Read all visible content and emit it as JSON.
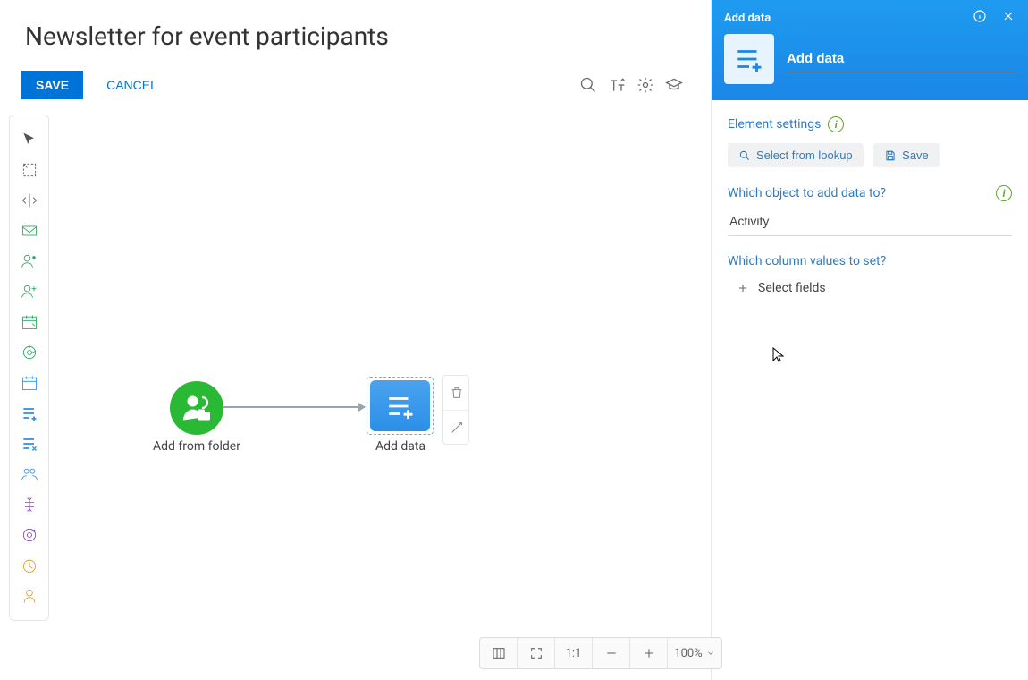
{
  "header": {
    "title": "Newsletter for event participants",
    "save_label": "SAVE",
    "cancel_label": "CANCEL"
  },
  "toolbar_icons": [
    "search-icon",
    "bookmark-icon",
    "settings-icon",
    "academy-icon"
  ],
  "canvas": {
    "nodes": [
      {
        "label": "Add from folder"
      },
      {
        "label": "Add data"
      }
    ]
  },
  "zoom": {
    "ratio_label": "1:1",
    "percent_label": "100%"
  },
  "panel": {
    "top_title": "Add data",
    "input_value": "Add data",
    "element_settings_label": "Element settings",
    "select_lookup_label": "Select from lookup",
    "save_label": "Save",
    "object_label": "Which object to add data to?",
    "object_value": "Activity",
    "columns_label": "Which column values to set?",
    "select_fields_label": "Select fields"
  }
}
